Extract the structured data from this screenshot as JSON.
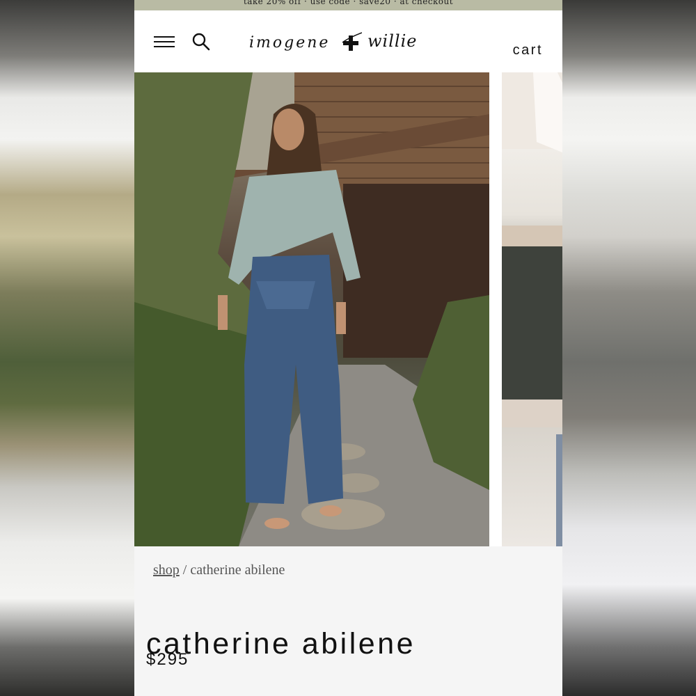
{
  "promo": {
    "text": "take 20% off · use code · save20 · at checkout"
  },
  "header": {
    "logo_left": "imogene",
    "logo_right": "willie",
    "cart_label": "cart"
  },
  "breadcrumb": {
    "shop": "shop",
    "separator": "/",
    "current": "catherine abilene"
  },
  "product": {
    "title": "catherine abilene",
    "price": "$295"
  },
  "icons": [
    "menu-icon",
    "search-icon",
    "plus-logo-icon"
  ]
}
